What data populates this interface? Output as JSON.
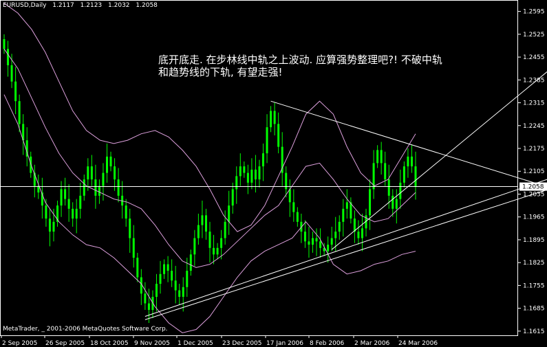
{
  "header": {
    "symbol": "EURUSD,Daily",
    "ohlc": [
      "1.2117",
      "1.2123",
      "1.2032",
      "1.2058"
    ]
  },
  "annotation": {
    "line1": "底开底走. 在步林线中轨之上波动. 应算强势整理吧?! 不破中轨",
    "line2": "和趋势线的下轨, 有望走强!"
  },
  "footer": {
    "copyright": "MetaTrader, _ 2001-2006 MetaQuotes Software Corp."
  },
  "colors": {
    "background": "#000000",
    "candle": "#00ff00",
    "bollinger": "#dda0dd",
    "trendline": "#ffffff",
    "text": "#ffffff",
    "price_marker_bg": "#ffffff"
  },
  "chart_data": {
    "type": "candlestick",
    "x_ticks": [
      "2 Sep 2005",
      "26 Sep 2005",
      "18 Oct 2005",
      "9 Nov 2005",
      "1 Dec 2005",
      "23 Dec 2005",
      "17 Jan 2006",
      "8 Feb 2006",
      "2 Mar 2006",
      "24 Mar 2006"
    ],
    "y_ticks": [
      "1.2595",
      "1.2525",
      "1.2455",
      "1.2385",
      "1.2315",
      "1.2245",
      "1.2175",
      "1.2105",
      "1.2035",
      "1.1965",
      "1.1895",
      "1.1825",
      "1.1755",
      "1.1685",
      "1.1615"
    ],
    "ylim": [
      1.16,
      1.263
    ],
    "current_price": "1.2058",
    "close": [
      1.248,
      1.243,
      1.238,
      1.232,
      1.225,
      1.22,
      1.215,
      1.21,
      1.206,
      1.204,
      1.2,
      1.196,
      1.192,
      1.195,
      1.2,
      1.205,
      1.202,
      1.199,
      1.196,
      1.199,
      1.203,
      1.208,
      1.212,
      1.208,
      1.203,
      1.206,
      1.21,
      1.215,
      1.212,
      1.208,
      1.203,
      1.2,
      1.196,
      1.19,
      1.184,
      1.178,
      1.173,
      1.17,
      1.168,
      1.172,
      1.176,
      1.179,
      1.182,
      1.18,
      1.177,
      1.174,
      1.172,
      1.175,
      1.18,
      1.185,
      1.19,
      1.194,
      1.197,
      1.192,
      1.187,
      1.185,
      1.187,
      1.19,
      1.195,
      1.2,
      1.205,
      1.209,
      1.212,
      1.21,
      1.207,
      1.211,
      1.208,
      1.212,
      1.216,
      1.224,
      1.229,
      1.225,
      1.218,
      1.21,
      1.205,
      1.201,
      1.198,
      1.195,
      1.192,
      1.189,
      1.188,
      1.19,
      1.189,
      1.187,
      1.186,
      1.188,
      1.19,
      1.192,
      1.195,
      1.199,
      1.201,
      1.196,
      1.192,
      1.19,
      1.193,
      1.197,
      1.205,
      1.213,
      1.217,
      1.213,
      1.208,
      1.203,
      1.199,
      1.202,
      1.207,
      1.212,
      1.215,
      1.212,
      1.2058
    ],
    "bollinger": {
      "upper": [
        1.262,
        1.259,
        1.254,
        1.247,
        1.238,
        1.229,
        1.223,
        1.22,
        1.219,
        1.22,
        1.222,
        1.223,
        1.221,
        1.217,
        1.212,
        1.205,
        1.197,
        1.192,
        1.194,
        1.2,
        1.209,
        1.218,
        1.228,
        1.232,
        1.228,
        1.218,
        1.21,
        1.206,
        1.208,
        1.215,
        1.222
      ],
      "middle": [
        1.248,
        1.242,
        1.233,
        1.224,
        1.216,
        1.21,
        1.206,
        1.204,
        1.202,
        1.201,
        1.199,
        1.194,
        1.188,
        1.183,
        1.181,
        1.182,
        1.185,
        1.189,
        1.193,
        1.197,
        1.2,
        1.206,
        1.212,
        1.213,
        1.208,
        1.202,
        1.197,
        1.195,
        1.196,
        1.2,
        1.204
      ],
      "lower": [
        1.234,
        1.225,
        1.212,
        1.201,
        1.195,
        1.191,
        1.188,
        1.187,
        1.184,
        1.18,
        1.176,
        1.169,
        1.164,
        1.161,
        1.162,
        1.166,
        1.172,
        1.178,
        1.183,
        1.186,
        1.188,
        1.19,
        1.195,
        1.19,
        1.182,
        1.179,
        1.18,
        1.182,
        1.183,
        1.185,
        1.186
      ]
    }
  }
}
